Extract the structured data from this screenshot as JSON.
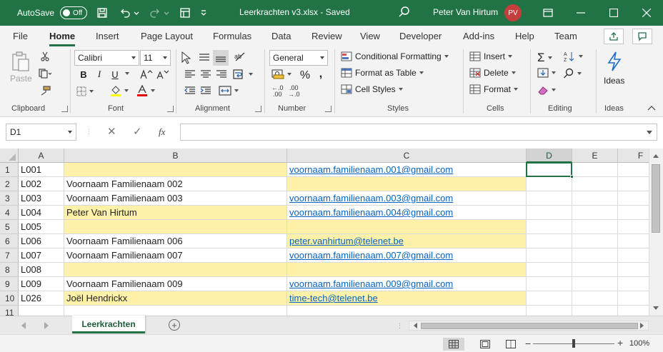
{
  "titlebar": {
    "autosave_label": "AutoSave",
    "autosave_state": "Off",
    "doc_title": "Leerkrachten v3.xlsx  -  Saved",
    "user_name": "Peter Van Hirtum",
    "user_initials": "PV",
    "accent_color": "#217346",
    "avatar_color": "#c43e3e"
  },
  "menu": {
    "tabs": [
      "File",
      "Home",
      "Insert",
      "Page Layout",
      "Formulas",
      "Data",
      "Review",
      "View",
      "Developer",
      "Add-ins",
      "Help",
      "Team"
    ],
    "active_tab": "Home"
  },
  "ribbon": {
    "groups": [
      "Clipboard",
      "Font",
      "Alignment",
      "Number",
      "Styles",
      "Cells",
      "Editing",
      "Ideas"
    ],
    "paste_label": "Paste",
    "font_name": "Calibri",
    "font_size": "11",
    "number_format": "General",
    "styles": {
      "conditional_formatting": "Conditional Formatting",
      "format_as_table": "Format as Table",
      "cell_styles": "Cell Styles"
    },
    "cells": {
      "insert": "Insert",
      "delete": "Delete",
      "format": "Format"
    },
    "ideas_label": "Ideas",
    "bold": "B",
    "italic": "I",
    "underline": "U"
  },
  "formula_bar": {
    "name_box": "D1",
    "fx_label": "fx",
    "value": ""
  },
  "sheet": {
    "columns": [
      "A",
      "B",
      "C",
      "D",
      "E",
      "F"
    ],
    "selected_column": "D",
    "active_cell": "D1",
    "highlight_color": "#fff2a8",
    "link_color": "#0563c1",
    "rows": [
      {
        "num": "1",
        "a": "L001",
        "b": "",
        "c": "voornaam.familienaam.001@gmail.com",
        "b_yellow": true,
        "c_yellow": false,
        "c_link": true
      },
      {
        "num": "2",
        "a": "L002",
        "b": "Voornaam Familienaam 002",
        "c": "",
        "b_yellow": false,
        "c_yellow": true,
        "c_link": false
      },
      {
        "num": "3",
        "a": "L003",
        "b": "Voornaam Familienaam 003",
        "c": "voornaam.familienaam.003@gmail.com",
        "b_yellow": false,
        "c_yellow": false,
        "c_link": true
      },
      {
        "num": "4",
        "a": "L004",
        "b": "Peter Van Hirtum",
        "c": "voornaam.familienaam.004@gmail.com",
        "b_yellow": true,
        "c_yellow": false,
        "c_link": true
      },
      {
        "num": "5",
        "a": "L005",
        "b": "",
        "c": "",
        "b_yellow": true,
        "c_yellow": true,
        "c_link": false
      },
      {
        "num": "6",
        "a": "L006",
        "b": "Voornaam Familienaam 006",
        "c": "peter.vanhirtum@telenet.be",
        "b_yellow": false,
        "c_yellow": true,
        "c_link": true
      },
      {
        "num": "7",
        "a": "L007",
        "b": "Voornaam Familienaam 007",
        "c": "voornaam.familienaam.007@gmail.com",
        "b_yellow": false,
        "c_yellow": false,
        "c_link": true
      },
      {
        "num": "8",
        "a": "L008",
        "b": "",
        "c": "",
        "b_yellow": true,
        "c_yellow": true,
        "c_link": false
      },
      {
        "num": "9",
        "a": "L009",
        "b": "Voornaam Familienaam 009",
        "c": "voornaam.familienaam.009@gmail.com",
        "b_yellow": false,
        "c_yellow": false,
        "c_link": true
      },
      {
        "num": "10",
        "a": "L026",
        "b": "Joël Hendrickx",
        "c": "time-tech@telenet.be",
        "b_yellow": true,
        "c_yellow": true,
        "c_link": true
      },
      {
        "num": "11",
        "a": "",
        "b": "",
        "c": "",
        "b_yellow": false,
        "c_yellow": false,
        "c_link": false
      }
    ]
  },
  "sheet_tabs": {
    "active": "Leerkrachten",
    "add_symbol": "+"
  },
  "statusbar": {
    "zoom": "100%"
  }
}
